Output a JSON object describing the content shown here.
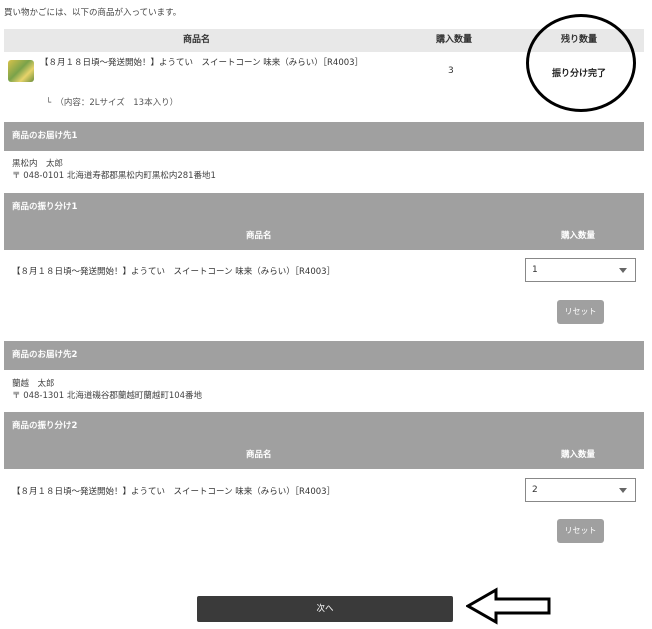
{
  "intro_text": "買い物かごには、以下の商品が入っています。",
  "cart_table": {
    "headers": {
      "product": "商品名",
      "quantity": "購入数量",
      "remaining": "残り数量"
    },
    "item": {
      "name": "【８月１８日頃～発送開始！】ようてい　スイートコーン 味来（みらい）［R4003］",
      "detail": "└　（内容：2Lサイズ　13本入り）",
      "quantity": "3",
      "remaining": "振り分け完了"
    }
  },
  "deliveries": [
    {
      "address_title": "商品のお届け先1",
      "recipient": "黒松内　太郎",
      "address": "〒 048-0101 北海道寿都郡黒松内町黒松内281番地1",
      "allocation_title": "商品の振り分け1",
      "col_product": "商品名",
      "col_quantity": "購入数量",
      "item_name": "【８月１８日頃～発送開始！】ようてい　スイートコーン 味来（みらい）［R4003］",
      "selected_quantity": "1",
      "reset_label": "リセット"
    },
    {
      "address_title": "商品のお届け先2",
      "recipient": "蘭越　太郎",
      "address": "〒 048-1301 北海道磯谷郡蘭越町蘭越町104番地",
      "allocation_title": "商品の振り分け2",
      "col_product": "商品名",
      "col_quantity": "購入数量",
      "item_name": "【８月１８日頃～発送開始！】ようてい　スイートコーン 味来（みらい）［R4003］",
      "selected_quantity": "2",
      "reset_label": "リセット"
    }
  ],
  "next_button_label": "次へ"
}
